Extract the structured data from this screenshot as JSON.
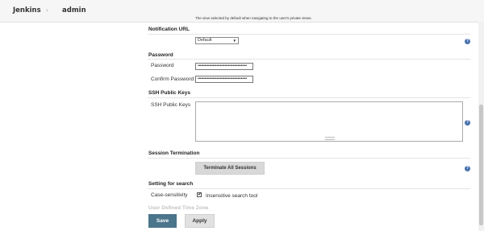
{
  "header": {
    "brand": "Jenkins",
    "separator": "›",
    "breadcrumb": "admin"
  },
  "view_hint": "The view selected by default when navigating to the user's private views.",
  "notification": {
    "title": "Notification URL",
    "selected": "Default",
    "caret": "▼"
  },
  "password": {
    "title": "Password",
    "password_label": "Password",
    "password_value": "••••••••••••••••••••••••••••••••••••••••••",
    "confirm_label": "Confirm Password:",
    "confirm_value": "••••••••••••••••••••••••••••••••••••••••••"
  },
  "ssh": {
    "title": "SSH Public Keys",
    "label": "SSH Public Keys"
  },
  "session": {
    "title": "Session Termination",
    "button": "Terminate All Sessions"
  },
  "search": {
    "title": "Setting for search",
    "label": "Case-sensitivity",
    "checkbox_label": "Insensitive search tool",
    "checked_mark": "✔"
  },
  "faded_next": "User Defined Time Zone",
  "actions": {
    "save": "Save",
    "apply": "Apply"
  },
  "help_glyph": "?",
  "colors": {
    "save_button": "#4b758b",
    "help_icon": "#4a72b0",
    "header_bg": "#f6f6f6"
  }
}
